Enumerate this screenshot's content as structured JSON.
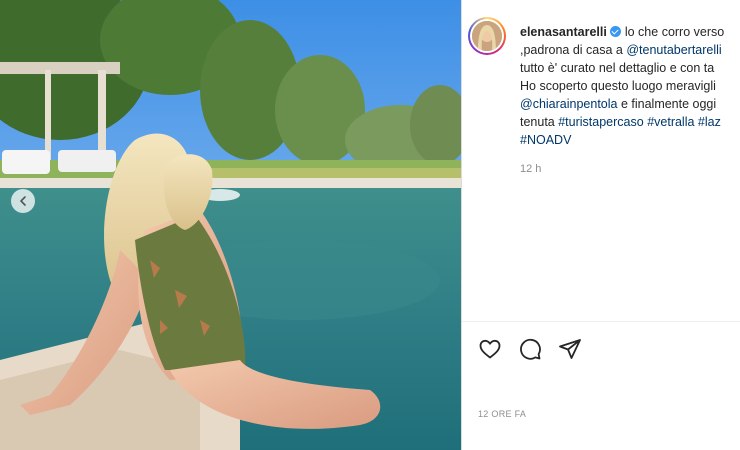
{
  "post": {
    "image_alt": "Woman in floral one-piece swimsuit sitting at the edge of a pool",
    "username": "elenasantarelli",
    "caption_lines": [
      [
        {
          "t": "lo che corro verso"
        }
      ],
      [
        {
          "t": ",padrona di casa a "
        },
        {
          "t": "@tenutabertarelli",
          "link": true
        }
      ],
      [
        {
          "t": "tutto è' curato nel dettaglio e con ta"
        }
      ],
      [
        {
          "t": "Ho scoperto questo luogo meravigli"
        }
      ],
      [
        {
          "t": "@chiarainpentola",
          "link": true
        },
        {
          "t": " e finalmente oggi"
        }
      ],
      [
        {
          "t": "tenuta "
        },
        {
          "t": "#turistapercaso",
          "link": true
        },
        {
          "t": " "
        },
        {
          "t": "#vetralla",
          "link": true
        },
        {
          "t": " "
        },
        {
          "t": "#laz",
          "link": true
        }
      ],
      [
        {
          "t": "#NOADV",
          "link": true
        }
      ]
    ],
    "comment_time": "12 h",
    "timestamp": "12 ORE FA"
  },
  "icons": {
    "prev": "chevron-left-icon",
    "like": "heart-icon",
    "comment": "comment-icon",
    "share": "send-icon"
  },
  "colors": {
    "link": "#00376b",
    "verified": "#3897f0",
    "muted": "#8e8e8e"
  }
}
